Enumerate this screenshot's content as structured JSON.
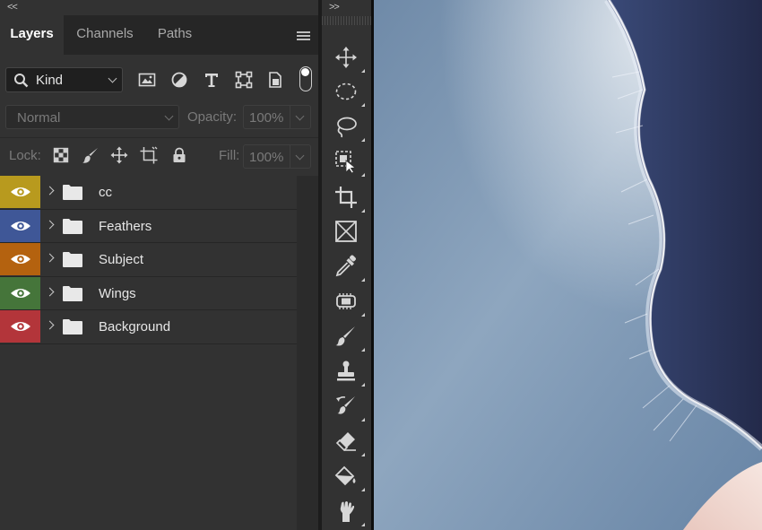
{
  "panel_collapse_glyph": "<<",
  "toolbar_collapse_glyph": ">>",
  "tabs": [
    {
      "label": "Layers",
      "active": true
    },
    {
      "label": "Channels",
      "active": false
    },
    {
      "label": "Paths",
      "active": false
    }
  ],
  "filter": {
    "kind_label": "Kind",
    "icons": [
      "image-filter-icon",
      "adjustment-filter-icon",
      "type-filter-icon",
      "shape-filter-icon",
      "smart-object-filter-icon"
    ]
  },
  "blend": {
    "mode": "Normal",
    "opacity_label": "Opacity:",
    "opacity_value": "100%"
  },
  "lock": {
    "label": "Lock:",
    "icons": [
      "lock-transparent-pixels-icon",
      "lock-image-pixels-icon",
      "lock-position-icon",
      "lock-artboard-icon",
      "lock-all-icon"
    ],
    "fill_label": "Fill:",
    "fill_value": "100%"
  },
  "layers": [
    {
      "name": "cc",
      "color": "#b89a1e",
      "visible": true,
      "type": "group"
    },
    {
      "name": "Feathers",
      "color": "#3f5797",
      "visible": true,
      "type": "group"
    },
    {
      "name": "Subject",
      "color": "#b4620f",
      "visible": true,
      "type": "group"
    },
    {
      "name": "Wings",
      "color": "#45753a",
      "visible": true,
      "type": "group"
    },
    {
      "name": "Background",
      "color": "#b3353a",
      "visible": true,
      "type": "group"
    }
  ],
  "tools": [
    "move-tool-icon",
    "marquee-tool-icon",
    "lasso-tool-icon",
    "object-selection-tool-icon",
    "crop-tool-icon",
    "frame-tool-icon",
    "eyedropper-tool-icon",
    "healing-brush-tool-icon",
    "brush-tool-icon",
    "clone-stamp-tool-icon",
    "history-brush-tool-icon",
    "eraser-tool-icon",
    "paint-bucket-tool-icon",
    "smudge-tool-icon"
  ],
  "colors": {
    "panel_bg": "#323232",
    "tab_bar_bg": "#262626",
    "sky_light": "#c3d1df",
    "sky_dark": "#5c7696",
    "subject_dark": "#262c4d"
  }
}
